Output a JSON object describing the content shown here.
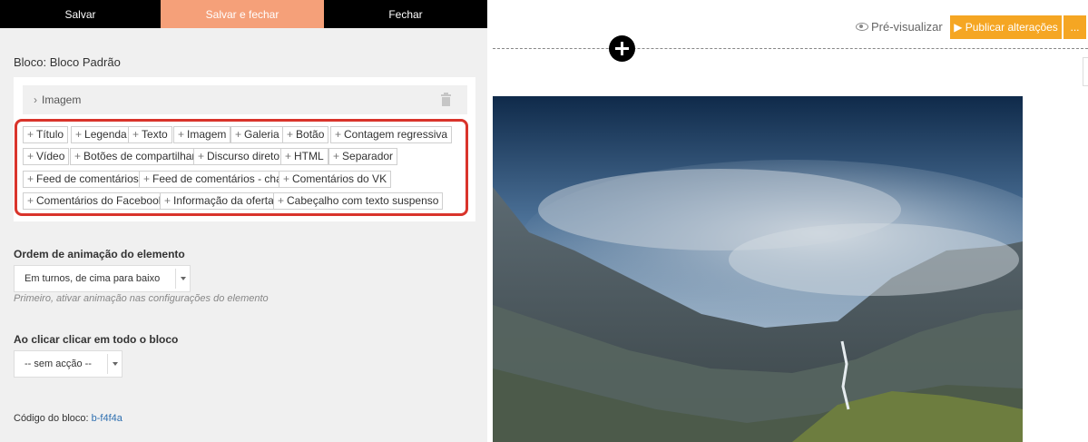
{
  "toolbar": {
    "save_label": "Salvar",
    "save_close_label": "Salvar e fechar",
    "close_label": "Fechar",
    "save_close_color": "#f5a079"
  },
  "panel": {
    "block_title": "Bloco: Bloco Padrão",
    "image_row_label": "Imagem",
    "element_chips": [
      "Título",
      "Legenda",
      "Texto",
      "Imagem",
      "Galeria",
      "Botão",
      "Contagem regressiva",
      "Vídeo",
      "Botões de compartilhar",
      "Discurso direto",
      "HTML",
      "Separador",
      "Feed de comentários",
      "Feed de comentários - chat",
      "Comentários do VK",
      "Comentários do Facebook",
      "Informação da oferta",
      "Cabeçalho com texto suspenso"
    ],
    "animation_order_label": "Ordem de animação do elemento",
    "animation_order_value": "Em turnos, de cima para baixo",
    "animation_hint": "Primeiro, ativar animação nas configurações do elemento",
    "click_label": "Ao clicar clicar em todo o bloco",
    "click_value": "-- sem acção --",
    "block_code_label": "Código do bloco:",
    "block_code_value": "b-f4f4a"
  },
  "header": {
    "preview_label": "Pré-visualizar",
    "publish_label": "▶ Publicar alterações",
    "more_label": "...",
    "publish_color": "#f5a623"
  },
  "icons": [
    "chevron-right-icon",
    "trash-icon",
    "plus-icon",
    "eye-icon",
    "add-block-icon"
  ]
}
